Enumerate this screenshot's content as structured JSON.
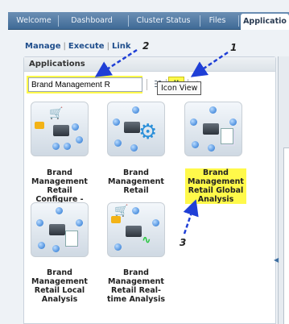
{
  "tabs": [
    {
      "label": "Welcome",
      "active": false
    },
    {
      "label": "Dashboard",
      "active": false
    },
    {
      "label": "Cluster Status",
      "active": false
    },
    {
      "label": "Files",
      "active": false
    },
    {
      "label": "Applicatio",
      "active": true
    }
  ],
  "subnav": {
    "manage": "Manage",
    "execute": "Execute",
    "link": "Link"
  },
  "panel": {
    "title": "Applications"
  },
  "search": {
    "value": "Brand Management R"
  },
  "toolbar": {
    "list_icon": "list-view-icon",
    "icon_view_icon": "icon-view-icon",
    "refresh_icon": "refresh-icon"
  },
  "tooltip": "Icon View",
  "annotations": [
    "1",
    "2",
    "3"
  ],
  "highlight_color": "#fff94a",
  "annotation_arrow_color": "#1f3fd6",
  "tiles": [
    {
      "label": "Brand Management Retail Configure -",
      "selected": false
    },
    {
      "label": "Brand Management Retail",
      "selected": false
    },
    {
      "label": "Brand Management Retail Global Analysis",
      "selected": true
    },
    {
      "label": "Brand Management Retail Local Analysis",
      "selected": false
    },
    {
      "label": "Brand Management Retail Real-time Analysis",
      "selected": false
    }
  ]
}
